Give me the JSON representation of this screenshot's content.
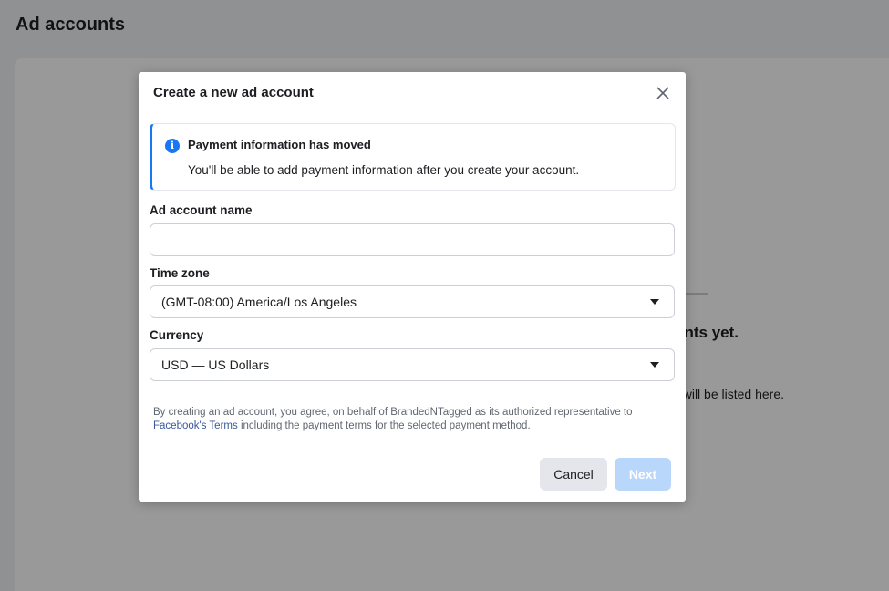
{
  "page": {
    "title": "Ad accounts",
    "empty_heading": "nts yet.",
    "empty_sub": "will be listed here."
  },
  "modal": {
    "title": "Create a new ad account",
    "notice": {
      "title": "Payment information has moved",
      "body": "You'll be able to add payment information after you create your account.",
      "icon": "info-icon"
    },
    "ad_account_name": {
      "label": "Ad account name",
      "value": "",
      "placeholder": ""
    },
    "time_zone": {
      "label": "Time zone",
      "value": "(GMT-08:00) America/Los Angeles"
    },
    "currency": {
      "label": "Currency",
      "value": "USD — US Dollars"
    },
    "terms": {
      "prefix": "By creating an ad account, you agree, on behalf of BrandedNTagged as its authorized representative to ",
      "link": "Facebook's Terms",
      "suffix": " including the payment terms for the selected payment method."
    },
    "buttons": {
      "cancel": "Cancel",
      "next": "Next"
    }
  },
  "colors": {
    "accent": "#1877f2",
    "next_disabled": "#b9d7fb",
    "link": "#385898"
  }
}
